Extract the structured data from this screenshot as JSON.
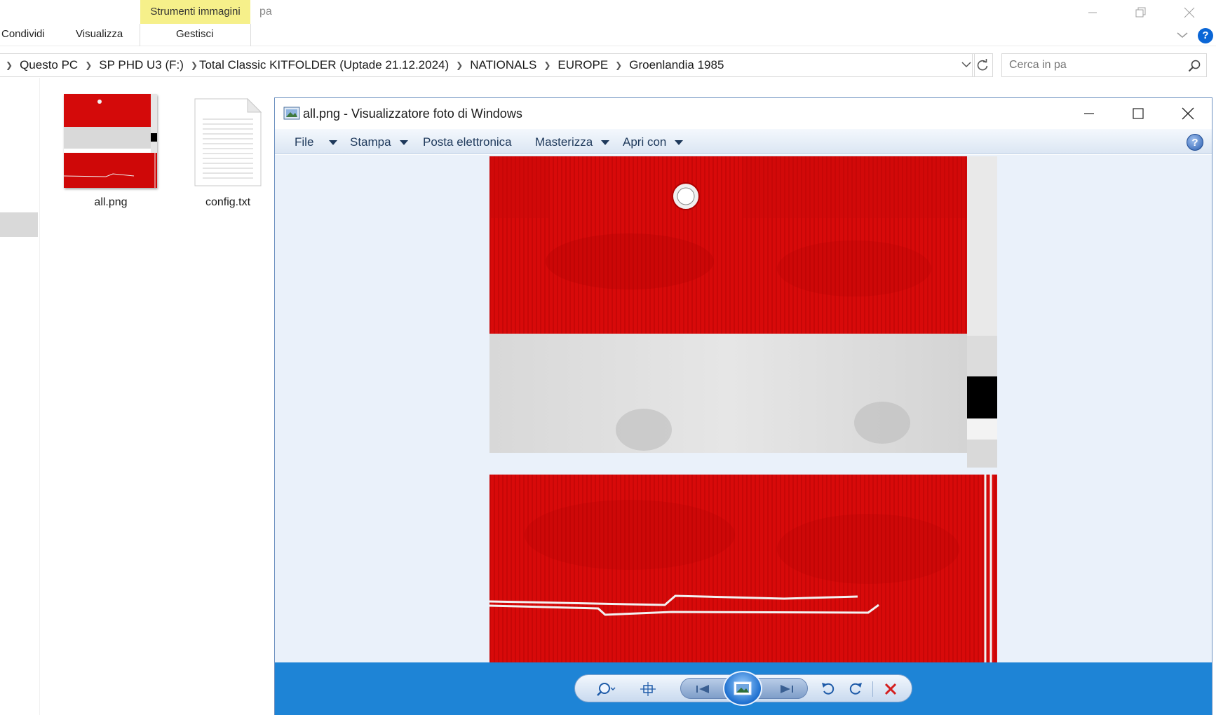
{
  "explorer": {
    "context_tab": "Strumenti immagini",
    "window_title_partial": "pa",
    "ribbon_tabs": [
      "Condividi",
      "Visualizza",
      "Gestisci"
    ],
    "breadcrumbs": [
      "Questo PC",
      "SP PHD U3 (F:)",
      "Total Classic KITFOLDER (Uptade 21.12.2024)",
      "NATIONALS",
      "EUROPE",
      "Groenlandia 1985"
    ],
    "search_placeholder": "Cerca in pa",
    "files": [
      {
        "name": "all.png",
        "icon": "image-thumbnail-icon"
      },
      {
        "name": "config.txt",
        "icon": "text-file-icon"
      }
    ],
    "help_label": "?"
  },
  "viewer": {
    "title": "all.png - Visualizzatore foto di Windows",
    "menu": {
      "file": "File",
      "print": "Stampa",
      "email": "Posta elettronica",
      "burn": "Masterizza",
      "open_with": "Apri con"
    },
    "help_label": "?",
    "controls": [
      "zoom-icon",
      "fit-window-icon",
      "previous-icon",
      "slideshow-icon",
      "next-icon",
      "rotate-left-icon",
      "rotate-right-icon",
      "delete-icon"
    ]
  },
  "colors": {
    "accent_blue": "#1e84d6",
    "kit_red": "#d40000",
    "kit_white": "#dcdcdc",
    "context_tab_yellow": "#f6f08a"
  }
}
